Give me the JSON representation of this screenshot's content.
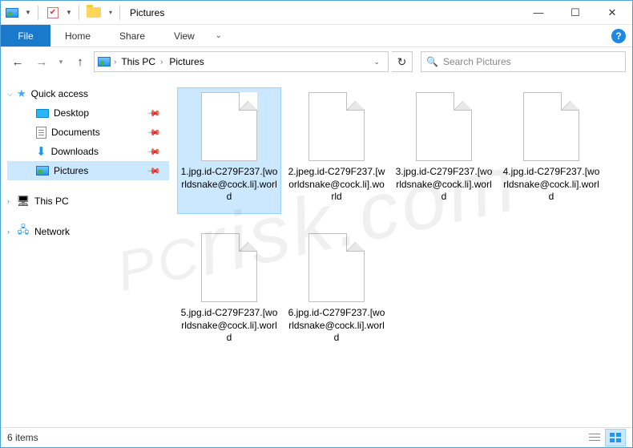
{
  "window": {
    "title": "Pictures"
  },
  "ribbon": {
    "file": "File",
    "tabs": [
      "Home",
      "Share",
      "View"
    ]
  },
  "nav": {
    "breadcrumbs": [
      {
        "label": "This PC"
      },
      {
        "label": "Pictures"
      }
    ],
    "search_placeholder": "Search Pictures"
  },
  "sidebar": {
    "quick_access": "Quick access",
    "items": [
      {
        "label": "Desktop",
        "icon": "desktop",
        "pinned": true
      },
      {
        "label": "Documents",
        "icon": "doc",
        "pinned": true
      },
      {
        "label": "Downloads",
        "icon": "down",
        "pinned": true
      },
      {
        "label": "Pictures",
        "icon": "pic",
        "pinned": true,
        "selected": true
      }
    ],
    "this_pc": "This PC",
    "network": "Network"
  },
  "files": [
    {
      "name": "1.jpg.id-C279F237.[worldsnake@cock.li].world",
      "selected": true
    },
    {
      "name": "2.jpeg.id-C279F237.[worldsnake@cock.li].world"
    },
    {
      "name": "3.jpg.id-C279F237.[worldsnake@cock.li].world"
    },
    {
      "name": "4.jpg.id-C279F237.[worldsnake@cock.li].world"
    },
    {
      "name": "5.jpg.id-C279F237.[worldsnake@cock.li].world"
    },
    {
      "name": "6.jpg.id-C279F237.[worldsnake@cock.li].world"
    }
  ],
  "status": {
    "count": "6 items"
  },
  "watermark": {
    "prefix": "PC",
    "text": "risk.com"
  }
}
